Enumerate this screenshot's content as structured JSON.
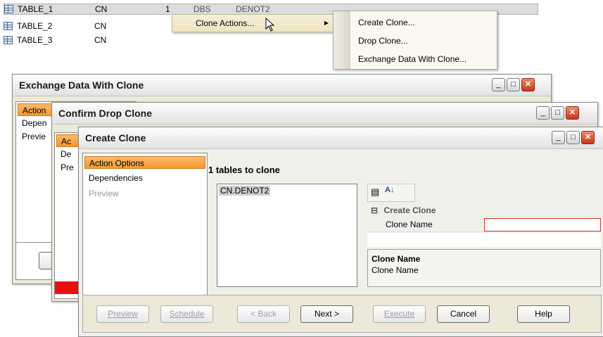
{
  "tables": [
    {
      "name": "TABLE_1",
      "schema": "CN",
      "extra1": "1",
      "extra2": "DBS",
      "extra3": "DENOT2"
    },
    {
      "name": "TABLE_2",
      "schema": "CN"
    },
    {
      "name": "TABLE_3",
      "schema": "CN"
    }
  ],
  "context_menu": {
    "clone_actions": "Clone Actions..."
  },
  "submenu": {
    "items": [
      "Create Clone...",
      "Drop Clone...",
      "Exchange Data With Clone..."
    ]
  },
  "win_exchange": {
    "title": "Exchange Data With Clone",
    "nav": [
      "Action",
      "Depen",
      "Previe"
    ]
  },
  "win_drop": {
    "title": "Confirm Drop Clone",
    "nav": [
      "Ac",
      "De",
      "Pre"
    ]
  },
  "win_create": {
    "title": "Create Clone",
    "nav": [
      "Action Options",
      "Dependencies",
      "Preview"
    ],
    "heading": "1 tables to clone",
    "list_items": [
      "CN.DENOT2"
    ],
    "property_group": "Create Clone",
    "property_label": "Clone Name",
    "property_value": "",
    "desc_title": "Clone Name",
    "desc_text": "Clone Name",
    "buttons": {
      "preview": "Preview",
      "schedule": "Schedule",
      "back": "< Back",
      "next": "Next >",
      "execute": "Execute",
      "cancel": "Cancel",
      "help": "Help"
    }
  },
  "colors": {
    "accent": "#f39a2f",
    "close": "#c8381a",
    "error_border": "#e03030",
    "selection": "#cfcfcf"
  }
}
